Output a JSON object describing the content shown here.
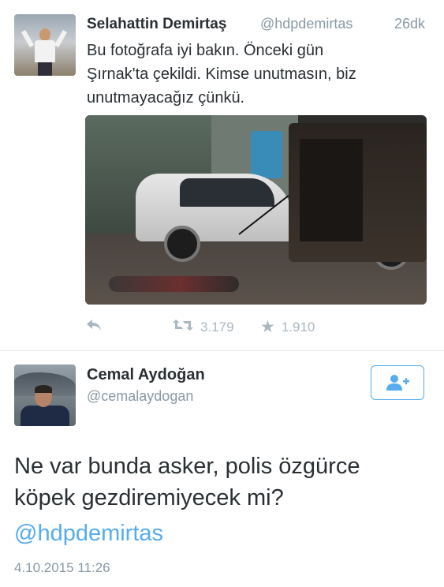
{
  "tweet1": {
    "author_name": "Selahattin Demirtaş",
    "handle": "@hdpdemirtas",
    "time": "26dk",
    "text_lines": [
      "Bu fotoğrafa iyi bakın. Önceki gün",
      "Şırnak'ta çekildi. Kimse unutmasın, biz",
      "unutmayacağız çünkü."
    ],
    "icons": {
      "reply": "reply-icon",
      "retweet": "retweet-icon",
      "favorite": "star-icon"
    },
    "retweet_count": "3.179",
    "favorite_count": "1.910"
  },
  "tweet2": {
    "author_name": "Cemal Aydoğan",
    "handle": "@cemalaydogan",
    "follow_icon": "add-user-icon",
    "text_lines": [
      "Ne var bunda asker, polis özgürce",
      "köpek gezdiremiyecek mi?"
    ],
    "mention": "@hdpdemirtas",
    "date": "4.10.2015 11:26"
  },
  "colors": {
    "accent": "#55acee",
    "text": "#292f33",
    "muted": "#8899a6",
    "action_gray": "#aab8c2",
    "divider": "#e1e8ed"
  }
}
